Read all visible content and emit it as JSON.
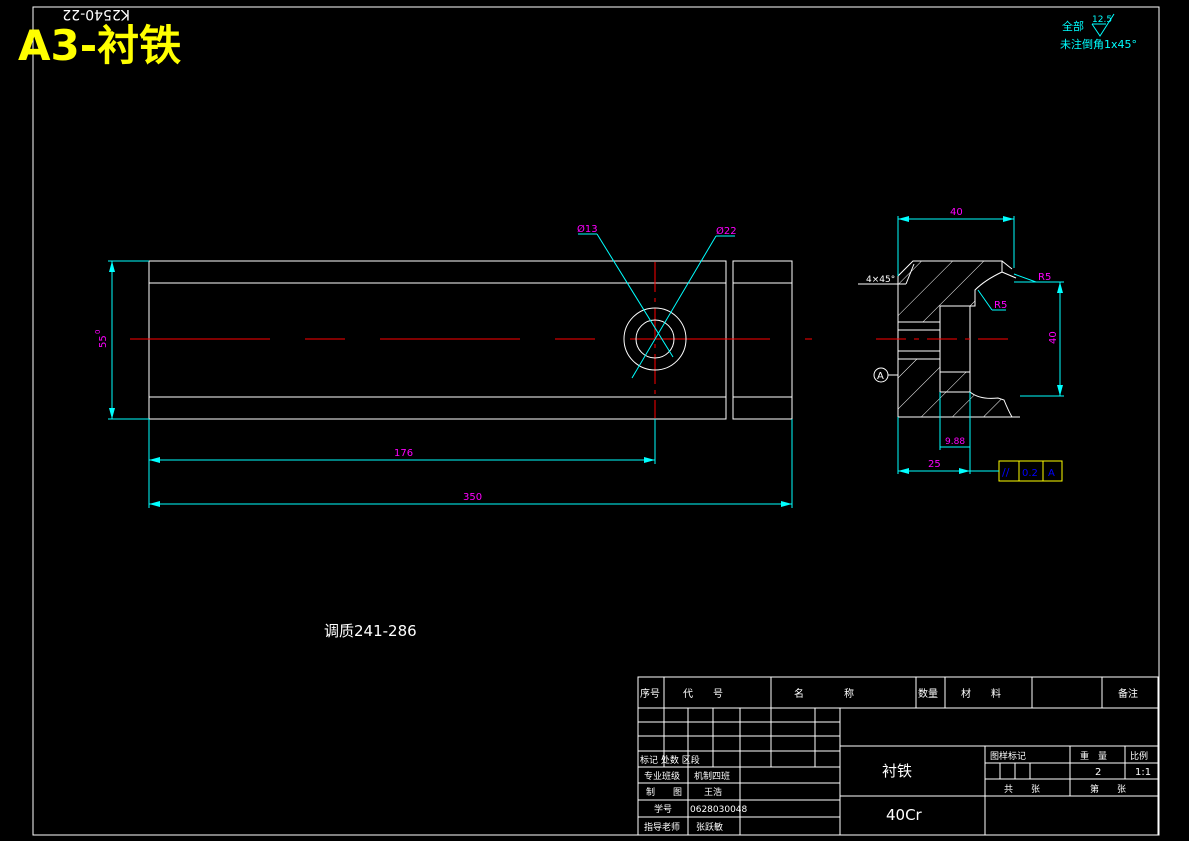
{
  "sheet": {
    "format_label": "A3-衬铁",
    "drawing_code_rotated": "K2540-22"
  },
  "notes": {
    "surface_all": "全部",
    "roughness": "12.5",
    "chamfer": "未注倒角1x45°",
    "heat_treatment": "调质241-286"
  },
  "dimensions": {
    "front": {
      "height": "55",
      "height_tol": "0",
      "hole_pos": "176",
      "length": "350",
      "hole_small": "Ø13",
      "hole_large": "Ø22"
    },
    "side": {
      "width": "40",
      "chamfer": "4×45°",
      "r_outer": "R5",
      "r_inner": "R5",
      "height": "40",
      "depth": "25",
      "offset": "9.88",
      "datum": "A",
      "tol_symbol": "//",
      "tol_value": "0.2",
      "tol_datum": "A"
    }
  },
  "title_block": {
    "header": {
      "index": "序号",
      "code": "代　　号",
      "name": "名　　　　称",
      "qty": "数量",
      "material": "材　　料",
      "remark": "备注"
    },
    "labels": {
      "mark": "标记 处数 区段",
      "major": "专业班级",
      "drawn": "制　　图",
      "student_no": "学号",
      "advisor": "指导老师",
      "stage": "图样标记",
      "weight": "重　量",
      "scale": "比例",
      "total": "共　　张",
      "sheet": "第　　张"
    },
    "values": {
      "major": "机制四班",
      "drawn": "王浩",
      "student_no": "0628030048",
      "advisor": "张跃敏",
      "part_name": "衬铁",
      "material": "40Cr",
      "weight": "2",
      "scale": "1:1"
    }
  },
  "colors": {
    "outline": "#ffffff",
    "dimension": "#00ffff",
    "dim_text": "#ff00ff",
    "centerline": "#ff0000",
    "note": "#00ffff",
    "title_text": "#ffff00",
    "datum_box": "#0000ff"
  }
}
